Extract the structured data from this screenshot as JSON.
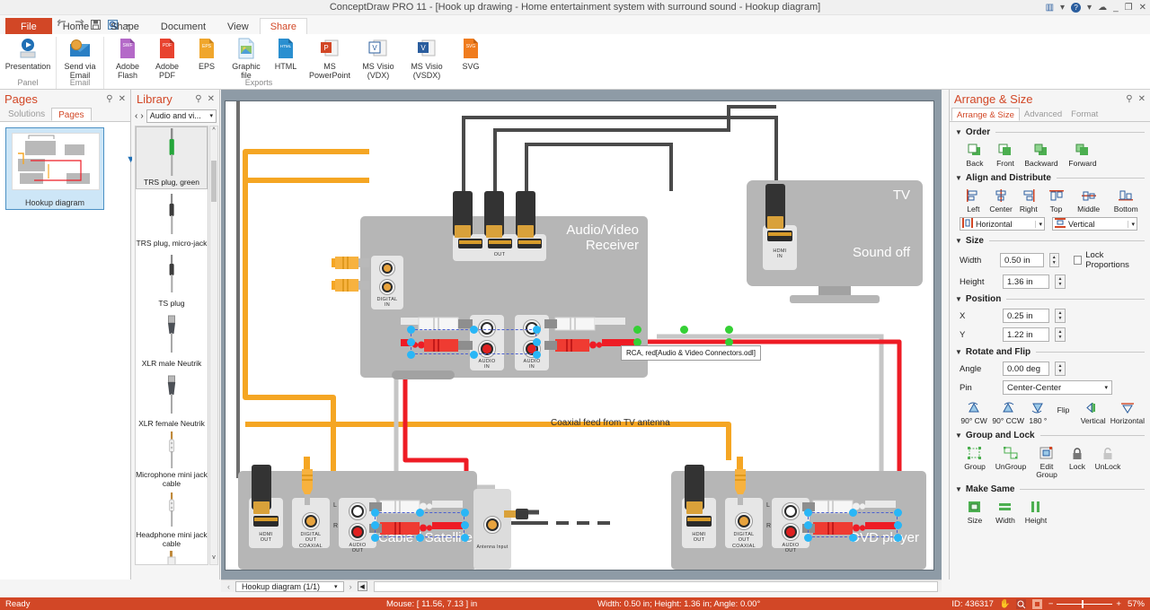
{
  "window": {
    "title": "ConceptDraw PRO 11 - [Hook up drawing - Home entertainment system with surround sound - Hookup diagram]",
    "minimize": "_",
    "maximize": "❐",
    "close": "✕",
    "cloud": "☁",
    "layout_icon": "▥",
    "help_icon": "?",
    "caret": "▾"
  },
  "quick_access": [
    "marker-icon",
    "new-doc-icon",
    "open-folder-icon",
    "undo-icon",
    "redo-icon",
    "save-icon",
    "preview-icon",
    "qa-caret"
  ],
  "tabs": [
    {
      "label": "File",
      "kind": "file"
    },
    {
      "label": "Home",
      "kind": "normal"
    },
    {
      "label": "Shape",
      "kind": "normal"
    },
    {
      "label": "Document",
      "kind": "normal"
    },
    {
      "label": "View",
      "kind": "normal"
    },
    {
      "label": "Share",
      "kind": "active"
    }
  ],
  "ribbon": {
    "groups": [
      {
        "title": "Panel",
        "items": [
          {
            "label": "Presentation",
            "icon": "presentation-icon",
            "wide": true
          }
        ]
      },
      {
        "title": "Email",
        "items": [
          {
            "label": "Send via Email",
            "icon": "email-icon",
            "wide": false
          }
        ]
      },
      {
        "title": "Exports",
        "items": [
          {
            "label": "Adobe Flash",
            "icon": "swf-icon",
            "wide": false
          },
          {
            "label": "Adobe PDF",
            "icon": "pdf-icon",
            "wide": false
          },
          {
            "label": "EPS",
            "icon": "eps-icon",
            "wide": false
          },
          {
            "label": "Graphic file",
            "icon": "graphic-file-icon",
            "wide": false
          },
          {
            "label": "HTML",
            "icon": "html-icon",
            "wide": false
          },
          {
            "label": "MS PowerPoint",
            "icon": "powerpoint-icon",
            "wide": true
          },
          {
            "label": "MS Visio (VDX)",
            "icon": "visio-vdx-icon",
            "wide": true
          },
          {
            "label": "MS Visio (VSDX)",
            "icon": "visio-vsdx-icon",
            "wide": true
          },
          {
            "label": "SVG",
            "icon": "svg-icon",
            "wide": false
          }
        ]
      }
    ]
  },
  "pages_panel": {
    "title": "Pages",
    "pin": "⚲",
    "close": "✕",
    "subtabs": [
      {
        "label": "Solutions",
        "active": false
      },
      {
        "label": "Pages",
        "active": true
      }
    ],
    "thumbnail_caption": "Hookup diagram",
    "caret": "▼"
  },
  "library_panel": {
    "title": "Library",
    "pin": "⚲",
    "close": "✕",
    "prev": "‹",
    "next": "›",
    "selected_library": "Audio and vi...",
    "caret": "▾",
    "scroll_up": "^",
    "scroll_down": "v",
    "items": [
      {
        "label": "TRS plug, green",
        "shape": "trs-plug-green",
        "selected": true
      },
      {
        "label": "TRS plug, micro-jack",
        "shape": "trs-plug-micro",
        "selected": false
      },
      {
        "label": "TS plug",
        "shape": "ts-plug",
        "selected": false
      },
      {
        "label": "XLR male Neutrik",
        "shape": "xlr-male",
        "selected": false
      },
      {
        "label": "XLR female Neutrik",
        "shape": "xlr-female",
        "selected": false
      },
      {
        "label": "Microphone mini jack cable",
        "shape": "mic-mini-jack",
        "selected": false
      },
      {
        "label": "Headphone mini jack cable",
        "shape": "headphone-mini-jack",
        "selected": false
      },
      {
        "label": "",
        "shape": "rca-partial",
        "selected": false
      }
    ]
  },
  "canvas": {
    "devices": [
      {
        "name": "receiver",
        "label": "Audio/Video\nReceiver",
        "label_line1": "Audio/Video",
        "label_line2": "Receiver"
      },
      {
        "name": "tv",
        "label_line1": "TV",
        "label_line2": "Sound off"
      },
      {
        "name": "cable-satellite",
        "label_line1": "Cable / Satellite"
      },
      {
        "name": "dvd-player",
        "label_line1": "DVD player"
      }
    ],
    "port_labels": {
      "out": "OUT",
      "digital_in_1": "DIGITAL",
      "digital_in_2": "IN",
      "audio_in_1": "AUDIO",
      "audio_in_2": "IN",
      "hdmi_in_1": "HDMI",
      "hdmi_in_2": "IN",
      "hdmi_out_1": "HDMI",
      "hdmi_out_2": "OUT",
      "digital_out_1": "DIGITAL",
      "digital_out_2": "OUT",
      "coaxial": "COAXIAL",
      "audio_out_1": "AUDIO",
      "audio_out_2": "OUT",
      "antenna_input": "Antenna Input",
      "left_ch": "L",
      "right_ch": "R"
    },
    "annotation": "Coaxial feed from TV antenna",
    "tooltip": "RCA, red[Audio & Video Connectors.odl]"
  },
  "arrange_panel": {
    "title": "Arrange & Size",
    "pin": "⚲",
    "close": "✕",
    "tabs": [
      {
        "label": "Arrange & Size",
        "active": true
      },
      {
        "label": "Advanced",
        "active": false
      },
      {
        "label": "Format",
        "active": false
      }
    ],
    "sections": {
      "order": {
        "title": "Order",
        "buttons": [
          {
            "label": "Back",
            "icon": "order-back-icon"
          },
          {
            "label": "Front",
            "icon": "order-front-icon"
          },
          {
            "label": "Backward",
            "icon": "order-backward-icon"
          },
          {
            "label": "Forward",
            "icon": "order-forward-icon"
          }
        ]
      },
      "align": {
        "title": "Align and Distribute",
        "buttons": [
          {
            "label": "Left",
            "icon": "align-left-icon"
          },
          {
            "label": "Center",
            "icon": "align-center-icon"
          },
          {
            "label": "Right",
            "icon": "align-right-icon"
          },
          {
            "label": "Top",
            "icon": "align-top-icon"
          },
          {
            "label": "Middle",
            "icon": "align-middle-icon"
          },
          {
            "label": "Bottom",
            "icon": "align-bottom-icon"
          }
        ],
        "distribute": [
          {
            "label": "Horizontal",
            "icon": "distribute-horizontal-icon",
            "caret": "▾"
          },
          {
            "label": "Vertical",
            "icon": "distribute-vertical-icon",
            "caret": "▾"
          }
        ]
      },
      "size": {
        "title": "Size",
        "width_label": "Width",
        "width_value": "0.50 in",
        "height_label": "Height",
        "height_value": "1.36 in",
        "lock_label": "Lock Proportions",
        "lock_checked": false
      },
      "position": {
        "title": "Position",
        "x_label": "X",
        "x_value": "0.25 in",
        "y_label": "Y",
        "y_value": "1.22 in"
      },
      "rotate": {
        "title": "Rotate and Flip",
        "angle_label": "Angle",
        "angle_value": "0.00 deg",
        "pin_label": "Pin",
        "pin_value": "Center-Center",
        "pin_caret": "▾",
        "buttons": [
          {
            "label": "90° CW",
            "icon": "rotate-cw-icon"
          },
          {
            "label": "90° CCW",
            "icon": "rotate-ccw-icon"
          },
          {
            "label": "180 °",
            "icon": "rotate-180-icon"
          }
        ],
        "flip_label": "Flip",
        "flip_buttons": [
          {
            "label": "Vertical",
            "icon": "flip-vertical-icon"
          },
          {
            "label": "Horizontal",
            "icon": "flip-horizontal-icon"
          }
        ]
      },
      "group": {
        "title": "Group and Lock",
        "buttons": [
          {
            "label": "Group",
            "icon": "group-icon"
          },
          {
            "label": "UnGroup",
            "icon": "ungroup-icon"
          },
          {
            "label": "Edit Group",
            "icon": "edit-group-icon"
          },
          {
            "label": "Lock",
            "icon": "lock-icon"
          },
          {
            "label": "UnLock",
            "icon": "unlock-icon"
          }
        ]
      },
      "make_same": {
        "title": "Make Same",
        "buttons": [
          {
            "label": "Size",
            "icon": "same-size-icon"
          },
          {
            "label": "Width",
            "icon": "same-width-icon"
          },
          {
            "label": "Height",
            "icon": "same-height-icon"
          }
        ]
      }
    }
  },
  "page_bar": {
    "prev": "‹",
    "next": "›",
    "tab_label": "Hookup diagram (1/1)",
    "tab_caret": "▾",
    "insert": "◀"
  },
  "status_bar": {
    "state": "Ready",
    "mouse": "Mouse: [ 11.56, 7.13 ] in",
    "dimensions": "Width: 0.50 in;  Height: 1.36 in;  Angle: 0.00°",
    "id": "ID: 436317",
    "hand_icon": "✋",
    "zoom_icon": "zoom-icon",
    "fit_icon": "fit-icon",
    "minus": "−",
    "plus": "+",
    "zoom_level": "57%"
  },
  "colors": {
    "accent": "#d24726",
    "handle_blue": "#29b6f6",
    "handle_green": "#35d035",
    "wire_yellow": "#f5a623",
    "wire_red": "#ee1c25",
    "wire_gray": "#c6c6c6",
    "wire_black": "#4a4a4a",
    "device_gray": "#b6b6b6"
  }
}
